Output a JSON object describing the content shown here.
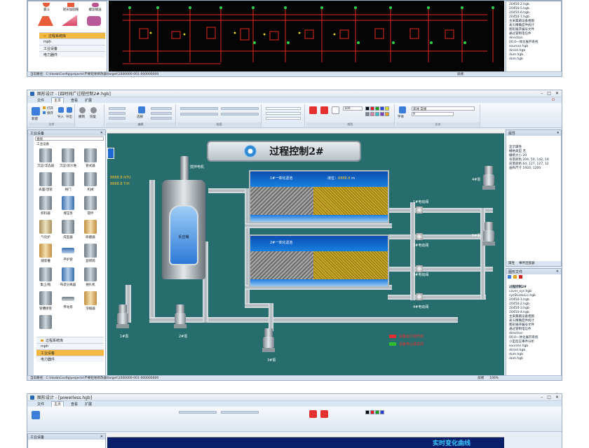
{
  "colors": {
    "canvas": "#286d6d",
    "accent": "#2a66b8",
    "selected_category": "#f4b942"
  },
  "top_window": {
    "lib_labels": [
      "漏斗",
      "矩形加圆锥",
      "螺旋输送"
    ],
    "categories": [
      "过程系统库",
      "mph",
      "工业设备",
      "电力器件"
    ],
    "status_path": "当前路径：C:\\Hada\\Config\\projects\\不要轻易修改器\\target\\1000000-001-000000000",
    "status_mid": "就绪",
    "tree_items": [
      "20450-2.hgb",
      "20450-5.hgb",
      "20450-6.hgb",
      "20450-7.hgb",
      "主采集箱设备相图",
      "表头精确度件统计",
      "图形展开编号文件",
      "通过管制电信件",
      "direction",
      "00.0一体化展开系统",
      "sources.hgb",
      "dirent.hgb",
      "dum.hgb",
      "dom.hgb"
    ]
  },
  "main_window": {
    "title": "图形设计 - [四时间广过程控制2#.hgb]",
    "menus": [
      "文件",
      "主页",
      "查看",
      "扩展"
    ],
    "ribbon": {
      "new_label": "新建",
      "open_label": "打开",
      "save_label": "保存",
      "import_label": "导入",
      "export_label": "导出",
      "undo_label": "撤销",
      "redo_label": "恢复",
      "select_label": "选择",
      "style_label": "字体",
      "font_name": "宋体 常规",
      "font_size": "9",
      "zoom_value": "100",
      "group_file": "文件",
      "group_edit": "编辑",
      "group_draw": "绘图",
      "group_color": "颜色",
      "group_text": "文本"
    },
    "library": {
      "header": "工业设备",
      "search_placeholder": "查找",
      "section": "工业设备",
      "items": [
        "沉淀/浮选器",
        "沉淀/泥沙堆",
        "管式器",
        "表面/湿管",
        "阀门",
        "机械",
        "卸料器",
        "增压泵",
        "搅拌",
        "气化炉",
        "成型器",
        "研磨器",
        "储浆槽",
        "平炉管",
        "旋转筒",
        "集尘/瓶",
        "布袋分离器",
        "捆扎机",
        "管槽接管",
        "传动系",
        "浓缩器",
        "",
        "",
        ""
      ],
      "categories": [
        "过程系统库",
        "mph",
        "工业设备",
        "电力器件"
      ]
    },
    "canvas": {
      "title": "过程控制2#",
      "tank_label": "反应桶",
      "top_tank": "1#一体化滤池",
      "bottom_tank": "2#一体化滤池",
      "level_label_1": "液位：",
      "level_value_1": "8888.8",
      "level_unit": "m",
      "readout_1_value": "8888.8",
      "readout_1_unit": "NTU",
      "readout_2_value": "8888.8",
      "readout_2_unit": "T/H",
      "agitator_label": "搅拌电机",
      "pumps": [
        "1#泵",
        "2#泵",
        "3#泵",
        "4#泵",
        "5#泵"
      ],
      "valves": [
        "1#电动阀",
        "2#电动阀",
        "3#电动阀",
        "4#电动阀"
      ],
      "legend_run": "设备运行或开启",
      "legend_stop": "设备停止或关闭"
    },
    "props": {
      "header": "属性",
      "group": "显示属性",
      "rows": [
        "栅格类型  无",
        "栅格大小  20",
        "背景颜色  204, 50, 142, 14",
        "前景颜色  64, 127, 127, 12",
        "画布尺寸  1920, 1200"
      ],
      "tabs": [
        "属性",
        "事件连接器"
      ]
    },
    "explorer": {
      "header": "图形文件",
      "items": [
        "过程控制2#",
        "cover_sys.hgb",
        "sysStudioLic.hgb",
        "20450-1.hgb",
        "20450-2.hgb",
        "20450-3.hgb",
        "20450-4.hgb",
        "主采集箱设备相图",
        "表头精确度件统计",
        "图形展开编号文件",
        "通过管制电信件",
        "direction",
        "00.0一体化展开系统",
        "小型反应事件分析",
        "sources.hgb",
        "dirent.hgb",
        "dum.hgb",
        "dom.hgb"
      ]
    },
    "status_path": "当前路径：C:\\Hada\\Config\\projects\\不要轻易修改器\\target\\1000000-001-000000000",
    "status_mid": "就绪",
    "zoom": "100%"
  },
  "bottom_window": {
    "title": "图形设计 - [powerless.hgb]",
    "menus": [
      "文件",
      "主页",
      "查看",
      "扩展"
    ],
    "library_header": "工业设备",
    "chart_title": "实时变化曲线"
  }
}
